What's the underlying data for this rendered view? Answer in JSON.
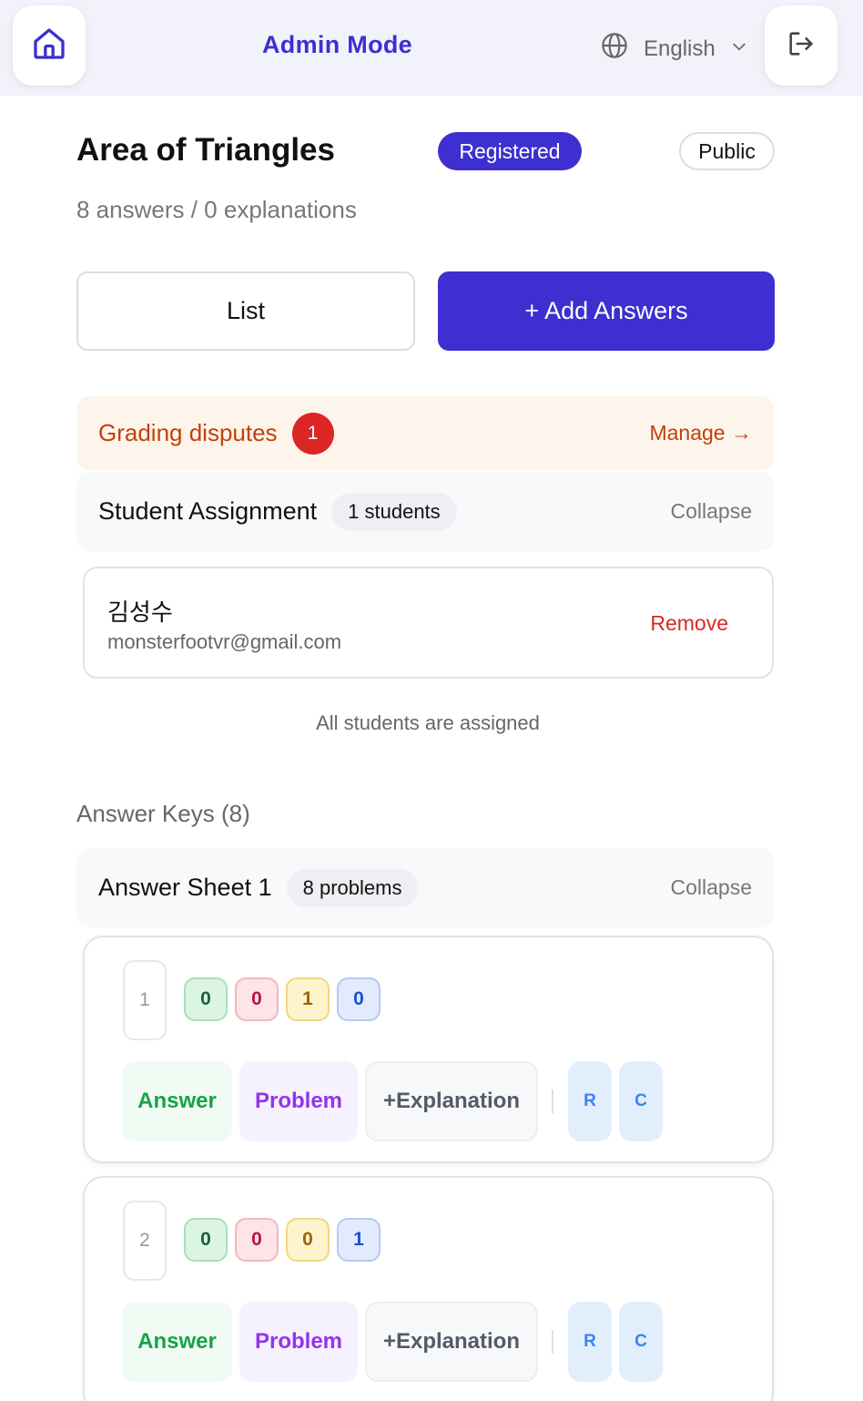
{
  "header": {
    "mode_title": "Admin Mode",
    "language": "English",
    "home_icon": "home-icon",
    "logout_icon": "logout-icon",
    "accent_color": "#3d2fd0"
  },
  "assignment": {
    "title": "Area of Triangles",
    "status_badge": "Registered",
    "visibility_badge": "Public",
    "subtitle": "8 answers / 0 explanations"
  },
  "actions": {
    "list_label": "List",
    "add_answers_label": "+ Add Answers"
  },
  "disputes": {
    "label": "Grading disputes",
    "count": "1",
    "manage_label": "Manage →"
  },
  "student_assignment": {
    "title": "Student Assignment",
    "count_label": "1 students",
    "collapse_label": "Collapse",
    "students": [
      {
        "name": "김성수",
        "email": "monsterfootvr@gmail.com",
        "remove_label": "Remove"
      }
    ],
    "all_assigned_text": "All students are assigned"
  },
  "answer_keys": {
    "heading": "Answer Keys (8)",
    "sheet": {
      "title": "Answer Sheet 1",
      "count_label": "8 problems",
      "collapse_label": "Collapse"
    },
    "problems": [
      {
        "number": "1",
        "chips": [
          "0",
          "0",
          "1",
          "0"
        ],
        "answer_label": "Answer",
        "problem_label": "Problem",
        "explanation_label": "+Explanation",
        "r_label": "R",
        "c_label": "C"
      },
      {
        "number": "2",
        "chips": [
          "0",
          "0",
          "0",
          "1"
        ],
        "answer_label": "Answer",
        "problem_label": "Problem",
        "explanation_label": "+Explanation",
        "r_label": "R",
        "c_label": "C"
      }
    ]
  }
}
